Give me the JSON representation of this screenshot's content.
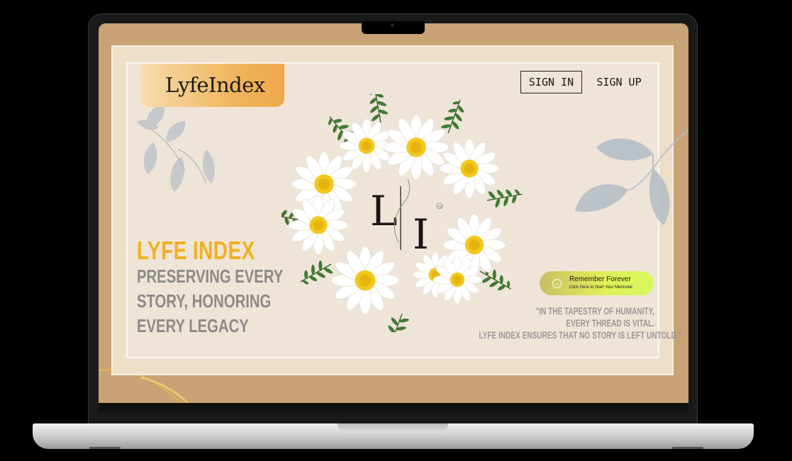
{
  "brand": {
    "logo": "LyfeIndex"
  },
  "nav": {
    "sign_in": "SIGN IN",
    "sign_up": "SIGN UP"
  },
  "hero": {
    "title": "LYFE INDEX",
    "subtitle_lines": [
      "PRESERVING EVERY",
      "STORY, HONORING",
      "EVERY LEGACY"
    ],
    "monogram": {
      "left": "L",
      "right": "I",
      "mark": "TM"
    }
  },
  "cta": {
    "title": "Remember Forever",
    "subtitle": "Click Here to Start Your Memorial",
    "icon": "arrow-right-circle-icon"
  },
  "quote": {
    "lines": [
      "\"IN THE TAPESTRY OF HUMANITY,",
      "EVERY THREAD IS VITAL.",
      "LYFE INDEX ENSURES THAT NO STORY IS LEFT UNTOLD.\""
    ]
  },
  "colors": {
    "screen_bg": "#c9a375",
    "page_bg": "#efe4d8",
    "accent_gold": "#f0b021",
    "text_gray": "#8c8a8a",
    "logo_gradient_end": "#eea84a",
    "cta_green": "#d6f85c"
  }
}
